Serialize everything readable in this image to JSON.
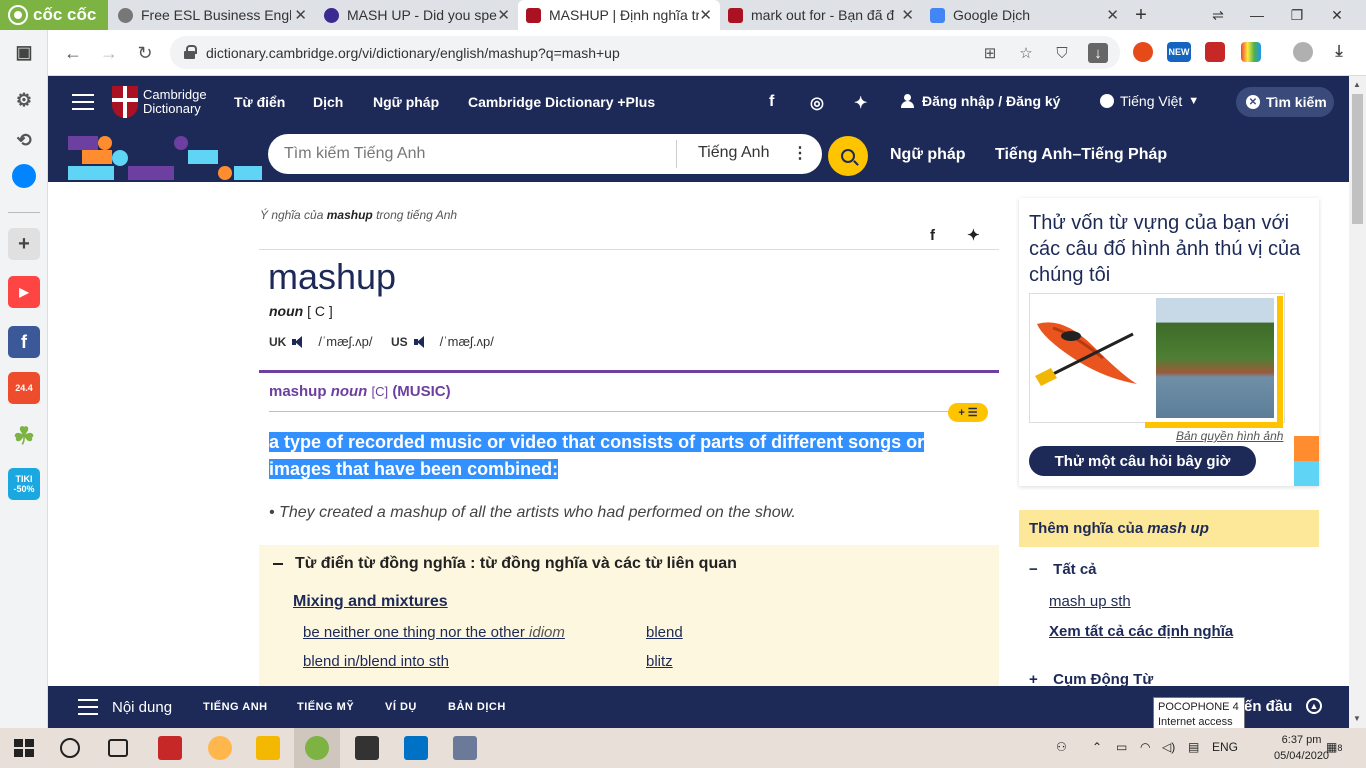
{
  "browser": {
    "brand": "cốc cốc",
    "tabs": [
      {
        "title": "Free ESL Business Englis",
        "active": false
      },
      {
        "title": "MASH UP - Did you spe",
        "active": false
      },
      {
        "title": "MASHUP | Định nghĩa tr",
        "active": true
      },
      {
        "title": "mark out for - Bạn đã đ",
        "active": false
      },
      {
        "title": "Google Dịch",
        "active": false
      }
    ],
    "url": "dictionary.cambridge.org/vi/dictionary/english/mashup?q=mash+up",
    "ext_new_label": "NEW"
  },
  "sidebar": {
    "tiki_label": "TIKI -50%",
    "shopee_label": "24.4"
  },
  "site": {
    "logo_line1": "Cambridge",
    "logo_line2": "Dictionary",
    "nav": [
      "Từ điển",
      "Dịch",
      "Ngữ pháp",
      "Cambridge Dictionary +Plus"
    ],
    "login": "Đăng nhập / Đăng ký",
    "language": "Tiếng Việt",
    "search_toggle": "Tìm kiếm",
    "search_placeholder": "Tìm kiếm Tiếng Anh",
    "search_lang": "Tiếng Anh",
    "band_links": [
      "Ngữ pháp",
      "Tiếng Anh–Tiếng Pháp"
    ]
  },
  "entry": {
    "crumb_prefix": "Ý nghĩa của",
    "crumb_word": "mashup",
    "crumb_suffix": "trong tiếng Anh",
    "headword": "mashup",
    "pos": "noun",
    "grammar": "[ C ]",
    "uk_label": "UK",
    "uk_ipa": "/ˈmæʃ.ʌp/",
    "us_label": "US",
    "us_ipa": "/ˈmæʃ.ʌp/",
    "sense_word": "mashup",
    "sense_pos": "noun",
    "sense_gram": "[C]",
    "sense_domain": "(MUSIC)",
    "add_label": "+ ☰",
    "definition": "a type of recorded music or video that consists of parts of different songs or images that have been combined:",
    "example": "They created a mashup of all the artists who had performed on the show."
  },
  "thesaurus": {
    "title": "Từ điển từ đồng nghĩa : từ đồng nghĩa và các từ liên quan",
    "category": "Mixing and mixtures",
    "left_items": [
      {
        "text": "be neither one thing nor the other",
        "note": "idiom"
      },
      {
        "text": "blend in/blend into sth",
        "note": ""
      }
    ],
    "right_items": [
      "blend",
      "blitz"
    ]
  },
  "quiz": {
    "title": "Thử vốn từ vựng của bạn với các câu đố hình ảnh thú vị của chúng tôi",
    "credit": "Bản quyền hình ảnh",
    "button": "Thử một câu hỏi bây giờ"
  },
  "more": {
    "prefix": "Thêm nghĩa của",
    "term": "mash up",
    "all_label": "Tất cả",
    "links": [
      "mash up sth",
      "Xem tất cả các định nghĩa"
    ],
    "phrasal": "Cụm Động Từ"
  },
  "bottombar": {
    "contents": "Nội dung",
    "tabs": [
      "TIẾNG ANH",
      "TIẾNG MỸ",
      "VÍ DỤ",
      "BẢN DỊCH"
    ],
    "end_label": "ến đầu"
  },
  "tooltip": {
    "line1": "POCOPHONE 4",
    "line2": "Internet access"
  },
  "taskbar": {
    "lang": "ENG",
    "time": "6:37 pm",
    "date": "05/04/2020",
    "notif": "8"
  }
}
